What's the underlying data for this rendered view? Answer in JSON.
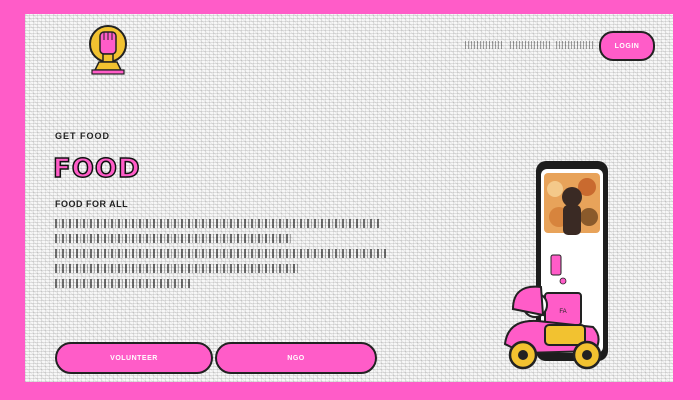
{
  "header": {
    "login_label": "LOGIN",
    "nav_items": [
      "",
      "",
      ""
    ]
  },
  "hero": {
    "tagline": "GET FOOD",
    "headline": "FOOD",
    "subheadline": "FOOD FOR ALL",
    "cta_volunteer": "VOLUNTEER",
    "cta_ngo": "NGO",
    "bag_label": "FA"
  },
  "colors": {
    "accent": "#ff5cc8",
    "outline": "#222222",
    "page_bg": "#f7f7f7",
    "frame": "#ff5cc8"
  },
  "icons": {
    "logo": "raised-fist-trophy-icon",
    "hero_illustration": "delivery-scooter-phone-illustration"
  }
}
